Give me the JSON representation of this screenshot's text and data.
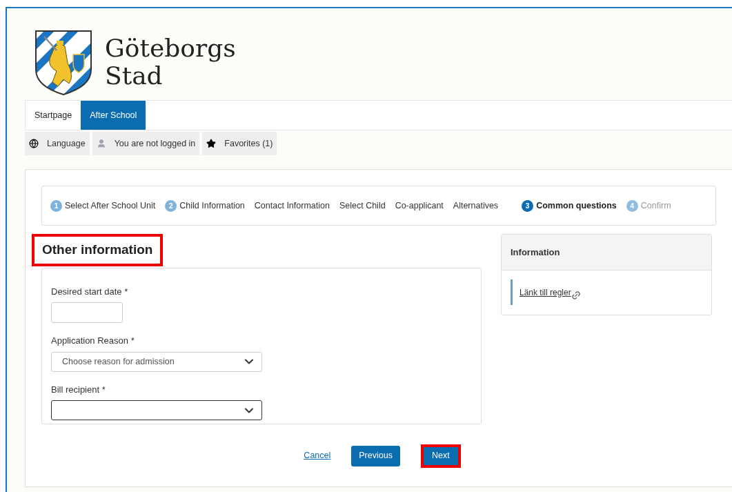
{
  "logo": {
    "line1": "Göteborgs",
    "line2": "Stad"
  },
  "tabs": [
    {
      "label": "Startpage",
      "selected": false
    },
    {
      "label": "After School",
      "selected": true
    }
  ],
  "utility_links": [
    {
      "kind": "globe",
      "label": "Language"
    },
    {
      "kind": "user",
      "label": "You are not logged in"
    },
    {
      "kind": "star",
      "label": "Favorites (1)"
    }
  ],
  "steps": [
    {
      "number": "1",
      "label": "Select After School Unit",
      "selected": false,
      "disabled": false
    },
    {
      "number": "2",
      "label": "Child Information",
      "selected": false,
      "disabled": false
    },
    {
      "label": "Contact Information",
      "selected": false,
      "disabled": false
    },
    {
      "label": "Select Child",
      "selected": false,
      "disabled": false
    },
    {
      "label": "Co-applicant",
      "selected": false,
      "disabled": false
    },
    {
      "label": "Alternatives",
      "selected": false,
      "disabled": false
    },
    {
      "number": "3",
      "label": "Common questions",
      "selected": true,
      "disabled": false
    },
    {
      "number": "4",
      "label": "Confirm",
      "selected": false,
      "disabled": true
    }
  ],
  "section": {
    "title": "Other information",
    "highlighted": true
  },
  "fields": [
    {
      "kind": "text",
      "label": "Desired start date",
      "required": "*"
    },
    {
      "kind": "select",
      "label": "Application Reason",
      "required": "*",
      "placeholder": "Choose reason for admission",
      "focused": false
    },
    {
      "kind": "select",
      "label": "Bill recipient",
      "required": "*",
      "focused": true
    }
  ],
  "info_panel": {
    "title": "Information",
    "link": "Länk till regler"
  },
  "actions": {
    "cancel": "Cancel",
    "previous": "Previous",
    "next": {
      "label": "Next",
      "highlighted": true
    }
  }
}
